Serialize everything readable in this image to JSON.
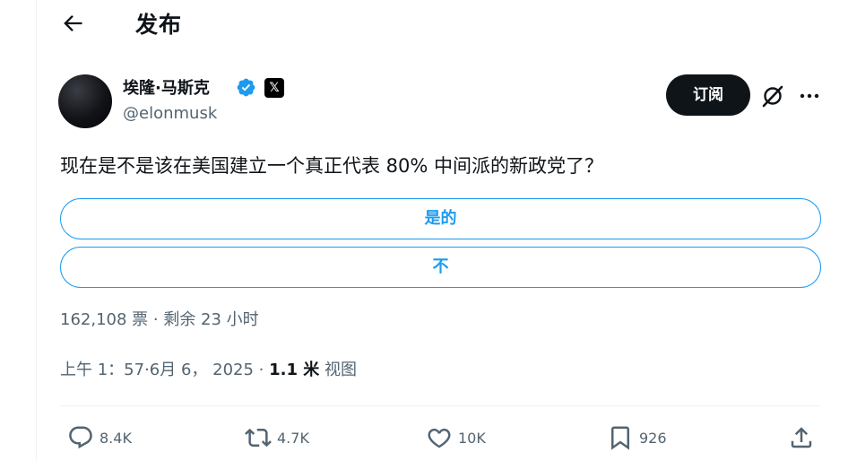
{
  "header": {
    "title": "发布"
  },
  "author": {
    "name": "埃隆·马斯克",
    "handle": "@elonmusk",
    "x_badge": "𝕏"
  },
  "subscribe_label": "订阅",
  "tweet": {
    "text": "现在是不是该在美国建立一个真正代表 80% 中间派的新政党了？"
  },
  "poll": {
    "options": [
      {
        "label": "是的"
      },
      {
        "label": "不"
      }
    ],
    "meta": "162,108 票 · 剩余 23 小时"
  },
  "timestamp": {
    "time": "上午 1：57·6月 6， 2025 · ",
    "views_count": "1.1 米",
    "views_label": " 视图"
  },
  "actions": {
    "replies": "8.4K",
    "reposts": "4.7K",
    "likes": "10K",
    "bookmarks": "926"
  },
  "colors": {
    "accent": "#1d9bf0",
    "text": "#0f1419",
    "muted": "#536471",
    "border": "#eff3f4"
  },
  "icons": [
    "back-arrow-icon",
    "verified-icon",
    "x-logo-icon",
    "grok-icon",
    "more-icon",
    "reply-icon",
    "repost-icon",
    "like-icon",
    "bookmark-icon",
    "share-icon"
  ]
}
